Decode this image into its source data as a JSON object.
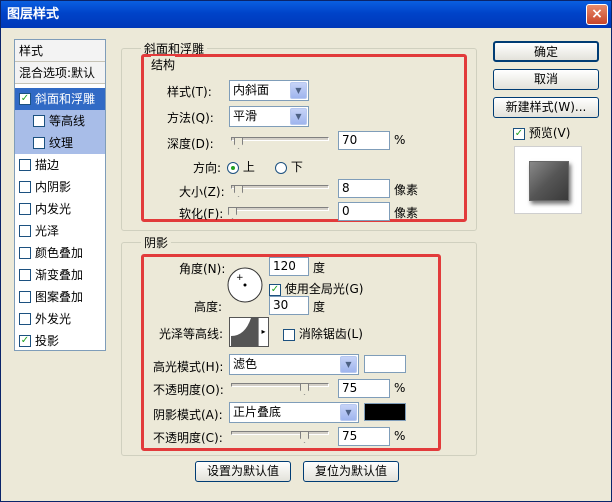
{
  "window": {
    "title": "图层样式",
    "close_label": "×"
  },
  "nav": {
    "items": [
      {
        "label": "样式",
        "type": "header"
      },
      {
        "label": "混合选项:默认",
        "type": "header"
      },
      {
        "label": "斜面和浮雕",
        "checked": true,
        "selected": true
      },
      {
        "label": "等高线",
        "checked": false,
        "sub": true
      },
      {
        "label": "纹理",
        "checked": false,
        "sub": true
      },
      {
        "label": "描边",
        "checked": false
      },
      {
        "label": "内阴影",
        "checked": false
      },
      {
        "label": "内发光",
        "checked": false
      },
      {
        "label": "光泽",
        "checked": false
      },
      {
        "label": "颜色叠加",
        "checked": false
      },
      {
        "label": "渐变叠加",
        "checked": false
      },
      {
        "label": "图案叠加",
        "checked": false
      },
      {
        "label": "外发光",
        "checked": false
      },
      {
        "label": "投影",
        "checked": true
      }
    ]
  },
  "bevel": {
    "group_title": "斜面和浮雕",
    "struct_title": "结构",
    "style_label": "样式(T):",
    "style_value": "内斜面",
    "technique_label": "方法(Q):",
    "technique_value": "平滑",
    "depth_label": "深度(D):",
    "depth_value": "70",
    "depth_unit": "%",
    "depth_level": 0.07,
    "direction_label": "方向:",
    "dir_up": "上",
    "dir_down": "下",
    "size_label": "大小(Z):",
    "size_value": "8",
    "size_unit": "像素",
    "soften_label": "软化(F):",
    "soften_value": "0",
    "soften_unit": "像素"
  },
  "shading": {
    "group_title": "阴影",
    "angle_label": "角度(N):",
    "angle_value": "120",
    "angle_unit": "度",
    "global_light_label": "使用全局光(G)",
    "global_light_checked": true,
    "altitude_label": "高度:",
    "altitude_value": "30",
    "altitude_unit": "度",
    "gloss_contour_label": "光泽等高线:",
    "anti_alias_label": "消除锯齿(L)",
    "highlight_mode_label": "高光模式(H):",
    "highlight_mode_value": "滤色",
    "highlight_color": "#ffffff",
    "highlight_opacity_label": "不透明度(O):",
    "highlight_opacity_value": "75",
    "highlight_opacity_unit": "%",
    "shadow_mode_label": "阴影模式(A):",
    "shadow_mode_value": "正片叠底",
    "shadow_color": "#000000",
    "shadow_opacity_label": "不透明度(C):",
    "shadow_opacity_value": "75",
    "shadow_opacity_unit": "%"
  },
  "buttons": {
    "ok": "确定",
    "cancel": "取消",
    "new_style": "新建样式(W)...",
    "preview": "预览(V)",
    "make_default": "设置为默认值",
    "reset_default": "复位为默认值"
  },
  "colors": {
    "highlight_red": "#e23b3b",
    "titlebar": "#0043c9"
  }
}
